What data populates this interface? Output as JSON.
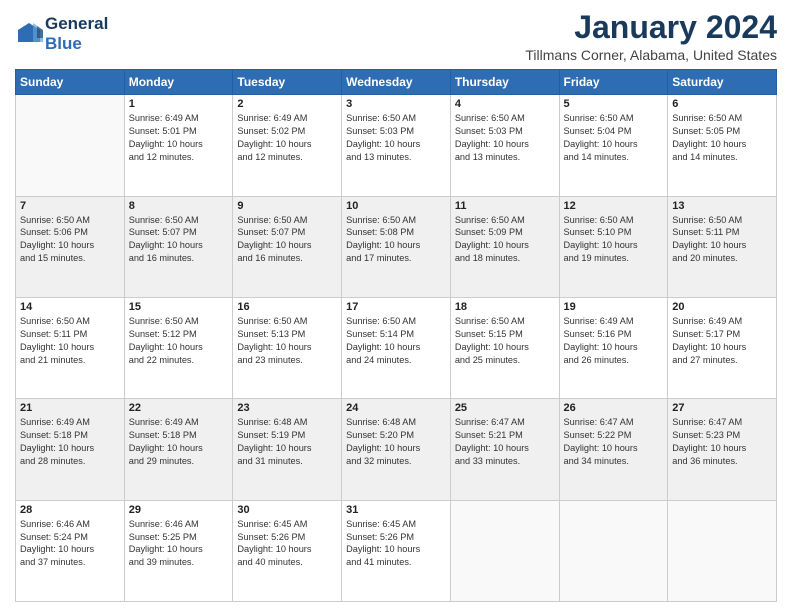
{
  "header": {
    "logo_line1": "General",
    "logo_line2": "Blue",
    "month": "January 2024",
    "location": "Tillmans Corner, Alabama, United States"
  },
  "days_of_week": [
    "Sunday",
    "Monday",
    "Tuesday",
    "Wednesday",
    "Thursday",
    "Friday",
    "Saturday"
  ],
  "weeks": [
    [
      {
        "day": "",
        "info": ""
      },
      {
        "day": "1",
        "info": "Sunrise: 6:49 AM\nSunset: 5:01 PM\nDaylight: 10 hours\nand 12 minutes."
      },
      {
        "day": "2",
        "info": "Sunrise: 6:49 AM\nSunset: 5:02 PM\nDaylight: 10 hours\nand 12 minutes."
      },
      {
        "day": "3",
        "info": "Sunrise: 6:50 AM\nSunset: 5:03 PM\nDaylight: 10 hours\nand 13 minutes."
      },
      {
        "day": "4",
        "info": "Sunrise: 6:50 AM\nSunset: 5:03 PM\nDaylight: 10 hours\nand 13 minutes."
      },
      {
        "day": "5",
        "info": "Sunrise: 6:50 AM\nSunset: 5:04 PM\nDaylight: 10 hours\nand 14 minutes."
      },
      {
        "day": "6",
        "info": "Sunrise: 6:50 AM\nSunset: 5:05 PM\nDaylight: 10 hours\nand 14 minutes."
      }
    ],
    [
      {
        "day": "7",
        "info": "Sunrise: 6:50 AM\nSunset: 5:06 PM\nDaylight: 10 hours\nand 15 minutes."
      },
      {
        "day": "8",
        "info": "Sunrise: 6:50 AM\nSunset: 5:07 PM\nDaylight: 10 hours\nand 16 minutes."
      },
      {
        "day": "9",
        "info": "Sunrise: 6:50 AM\nSunset: 5:07 PM\nDaylight: 10 hours\nand 16 minutes."
      },
      {
        "day": "10",
        "info": "Sunrise: 6:50 AM\nSunset: 5:08 PM\nDaylight: 10 hours\nand 17 minutes."
      },
      {
        "day": "11",
        "info": "Sunrise: 6:50 AM\nSunset: 5:09 PM\nDaylight: 10 hours\nand 18 minutes."
      },
      {
        "day": "12",
        "info": "Sunrise: 6:50 AM\nSunset: 5:10 PM\nDaylight: 10 hours\nand 19 minutes."
      },
      {
        "day": "13",
        "info": "Sunrise: 6:50 AM\nSunset: 5:11 PM\nDaylight: 10 hours\nand 20 minutes."
      }
    ],
    [
      {
        "day": "14",
        "info": "Sunrise: 6:50 AM\nSunset: 5:11 PM\nDaylight: 10 hours\nand 21 minutes."
      },
      {
        "day": "15",
        "info": "Sunrise: 6:50 AM\nSunset: 5:12 PM\nDaylight: 10 hours\nand 22 minutes."
      },
      {
        "day": "16",
        "info": "Sunrise: 6:50 AM\nSunset: 5:13 PM\nDaylight: 10 hours\nand 23 minutes."
      },
      {
        "day": "17",
        "info": "Sunrise: 6:50 AM\nSunset: 5:14 PM\nDaylight: 10 hours\nand 24 minutes."
      },
      {
        "day": "18",
        "info": "Sunrise: 6:50 AM\nSunset: 5:15 PM\nDaylight: 10 hours\nand 25 minutes."
      },
      {
        "day": "19",
        "info": "Sunrise: 6:49 AM\nSunset: 5:16 PM\nDaylight: 10 hours\nand 26 minutes."
      },
      {
        "day": "20",
        "info": "Sunrise: 6:49 AM\nSunset: 5:17 PM\nDaylight: 10 hours\nand 27 minutes."
      }
    ],
    [
      {
        "day": "21",
        "info": "Sunrise: 6:49 AM\nSunset: 5:18 PM\nDaylight: 10 hours\nand 28 minutes."
      },
      {
        "day": "22",
        "info": "Sunrise: 6:49 AM\nSunset: 5:18 PM\nDaylight: 10 hours\nand 29 minutes."
      },
      {
        "day": "23",
        "info": "Sunrise: 6:48 AM\nSunset: 5:19 PM\nDaylight: 10 hours\nand 31 minutes."
      },
      {
        "day": "24",
        "info": "Sunrise: 6:48 AM\nSunset: 5:20 PM\nDaylight: 10 hours\nand 32 minutes."
      },
      {
        "day": "25",
        "info": "Sunrise: 6:47 AM\nSunset: 5:21 PM\nDaylight: 10 hours\nand 33 minutes."
      },
      {
        "day": "26",
        "info": "Sunrise: 6:47 AM\nSunset: 5:22 PM\nDaylight: 10 hours\nand 34 minutes."
      },
      {
        "day": "27",
        "info": "Sunrise: 6:47 AM\nSunset: 5:23 PM\nDaylight: 10 hours\nand 36 minutes."
      }
    ],
    [
      {
        "day": "28",
        "info": "Sunrise: 6:46 AM\nSunset: 5:24 PM\nDaylight: 10 hours\nand 37 minutes."
      },
      {
        "day": "29",
        "info": "Sunrise: 6:46 AM\nSunset: 5:25 PM\nDaylight: 10 hours\nand 39 minutes."
      },
      {
        "day": "30",
        "info": "Sunrise: 6:45 AM\nSunset: 5:26 PM\nDaylight: 10 hours\nand 40 minutes."
      },
      {
        "day": "31",
        "info": "Sunrise: 6:45 AM\nSunset: 5:26 PM\nDaylight: 10 hours\nand 41 minutes."
      },
      {
        "day": "",
        "info": ""
      },
      {
        "day": "",
        "info": ""
      },
      {
        "day": "",
        "info": ""
      }
    ]
  ]
}
